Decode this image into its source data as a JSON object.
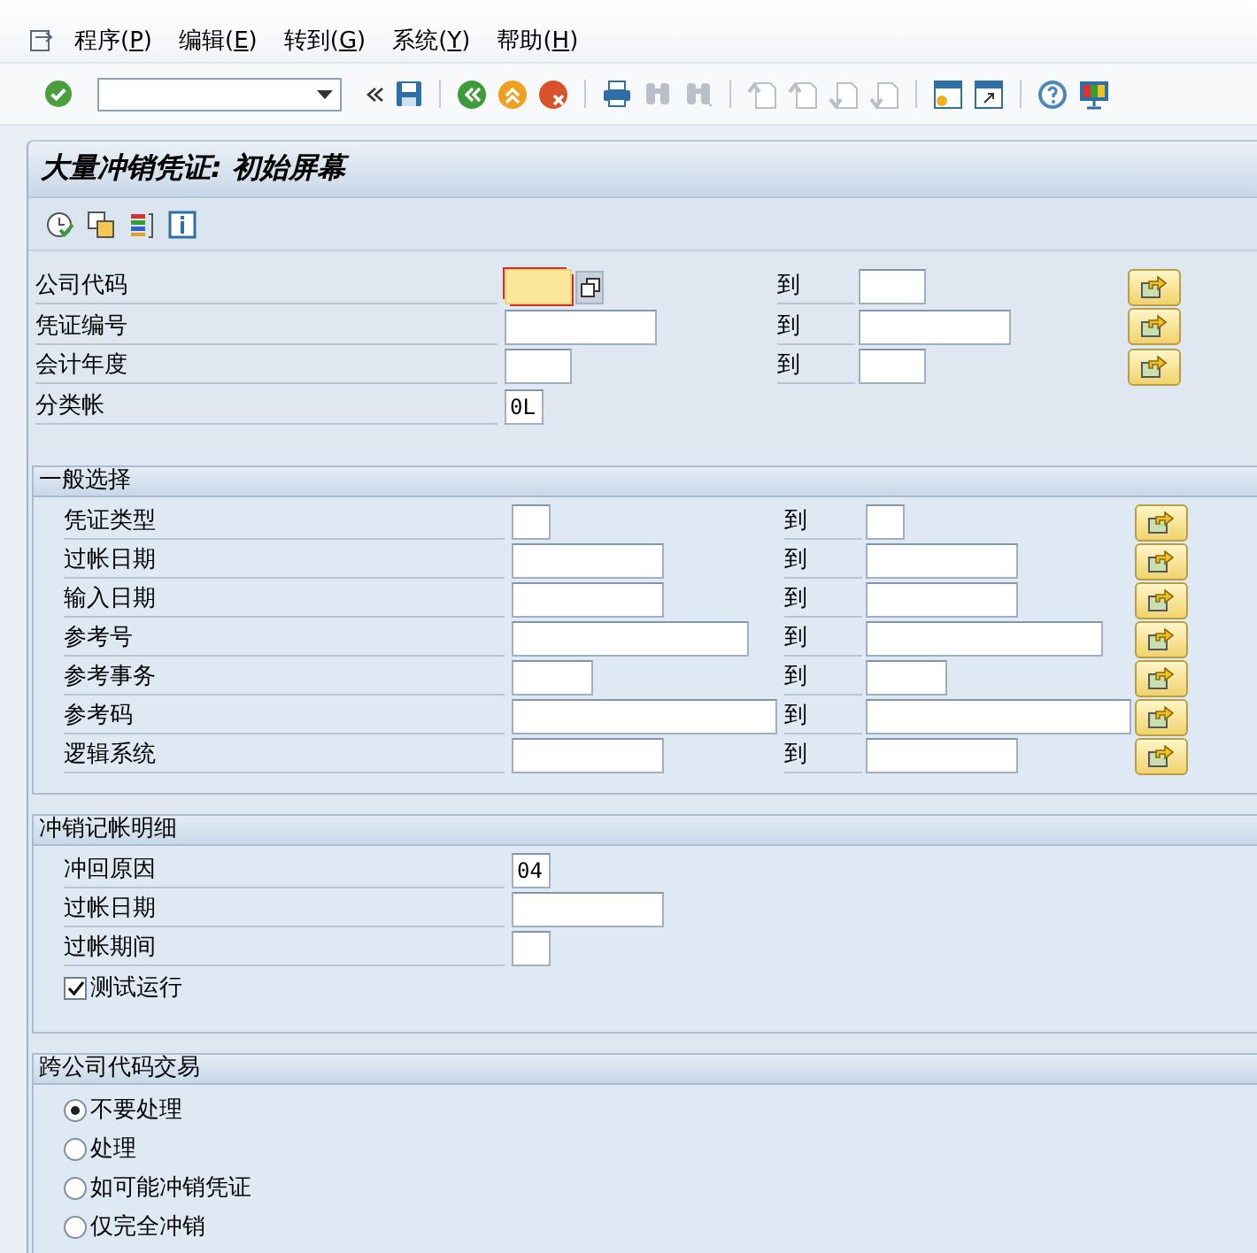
{
  "menu": [
    {
      "label": "程序(P)"
    },
    {
      "label": "编辑(E)"
    },
    {
      "label": "转到(G)"
    },
    {
      "label": "系统(Y)"
    },
    {
      "label": "帮助(H)"
    }
  ],
  "title": "大量冲销凭证: 初始屏幕",
  "selection": [
    {
      "kind": "range",
      "label": "公司代码",
      "focused": true,
      "to_label": "到"
    },
    {
      "kind": "range",
      "label": "凭证编号",
      "focused": false,
      "to_label": "到"
    },
    {
      "kind": "range",
      "label": "会计年度",
      "focused": false,
      "to_label": "到"
    },
    {
      "kind": "single",
      "label": "分类帐",
      "focused": false,
      "value": "0L"
    }
  ],
  "groups": [
    {
      "title": "一般选择",
      "items": [
        {
          "kind": "range",
          "label": "凭证类型",
          "to_label": "到"
        },
        {
          "kind": "range",
          "label": "过帐日期",
          "to_label": "到"
        },
        {
          "kind": "range",
          "label": "输入日期",
          "to_label": "到"
        },
        {
          "kind": "range",
          "label": "参考号",
          "to_label": "到"
        },
        {
          "kind": "range",
          "label": "参考事务",
          "to_label": "到"
        },
        {
          "kind": "range",
          "label": "参考码",
          "to_label": "到"
        },
        {
          "kind": "range",
          "label": "逻辑系统",
          "to_label": "到"
        }
      ]
    },
    {
      "title": "冲销记帐明细",
      "items": [
        {
          "kind": "single",
          "label": "冲回原因",
          "value": "04"
        },
        {
          "kind": "single",
          "label": "过帐日期"
        },
        {
          "kind": "single",
          "label": "过帐期间"
        },
        {
          "kind": "checkbox",
          "label": "测试运行",
          "checked": true
        }
      ]
    },
    {
      "title": "跨公司代码交易",
      "items": [
        {
          "kind": "radio",
          "label": "不要处理",
          "selected": true
        },
        {
          "kind": "radio",
          "label": "处理",
          "selected": false
        },
        {
          "kind": "radio",
          "label": "如可能冲销凭证",
          "selected": false
        },
        {
          "kind": "radio",
          "label": "仅完全冲销",
          "selected": false
        }
      ]
    }
  ]
}
